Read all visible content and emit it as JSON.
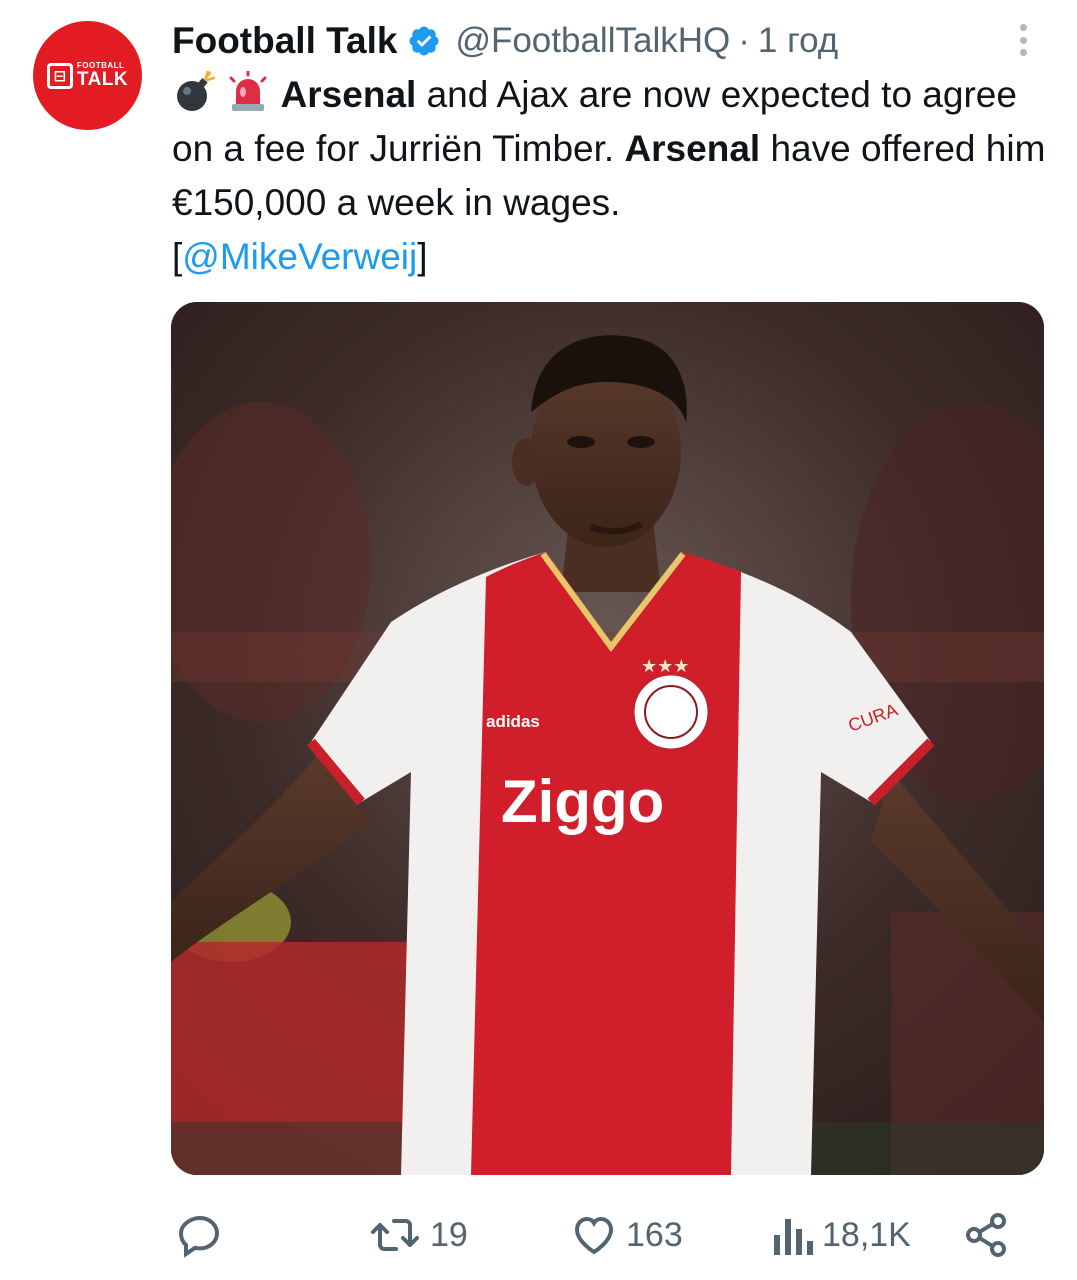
{
  "author": {
    "display_name": "Football Talk",
    "handle": "@FootballTalkHQ",
    "separator": "·",
    "time": "1 год",
    "avatar_text_small": "FOOTBALL",
    "avatar_text_big": "TALK"
  },
  "tweet": {
    "segments": [
      {
        "text": "Arsenal",
        "bold": true
      },
      {
        "text": " and Ajax are now expected to agree on a fee for Jurriën Timber. ",
        "bold": false
      },
      {
        "text": "Arsenal",
        "bold": true
      },
      {
        "text": " have offered him €150,000 a week in wages.",
        "bold": false
      }
    ],
    "emoji": [
      "bomb",
      "police-light"
    ],
    "source_open": "[",
    "mention": "@MikeVerweij",
    "source_close": "]"
  },
  "media": {
    "shirt_sponsor": "Ziggo",
    "shirt_brand": "adidas",
    "sleeve_text": "CURA"
  },
  "actions": {
    "reply_count": "",
    "retweet_count": "19",
    "like_count": "163",
    "views_count": "18,1K"
  },
  "colors": {
    "brand_red": "#e31b23",
    "verified_blue": "#1d9bf0",
    "muted_text": "#536471",
    "link": "#1d9bf0"
  },
  "icons": [
    "verified-badge-icon",
    "more-icon",
    "reply-icon",
    "retweet-icon",
    "like-icon",
    "views-icon",
    "share-icon"
  ]
}
